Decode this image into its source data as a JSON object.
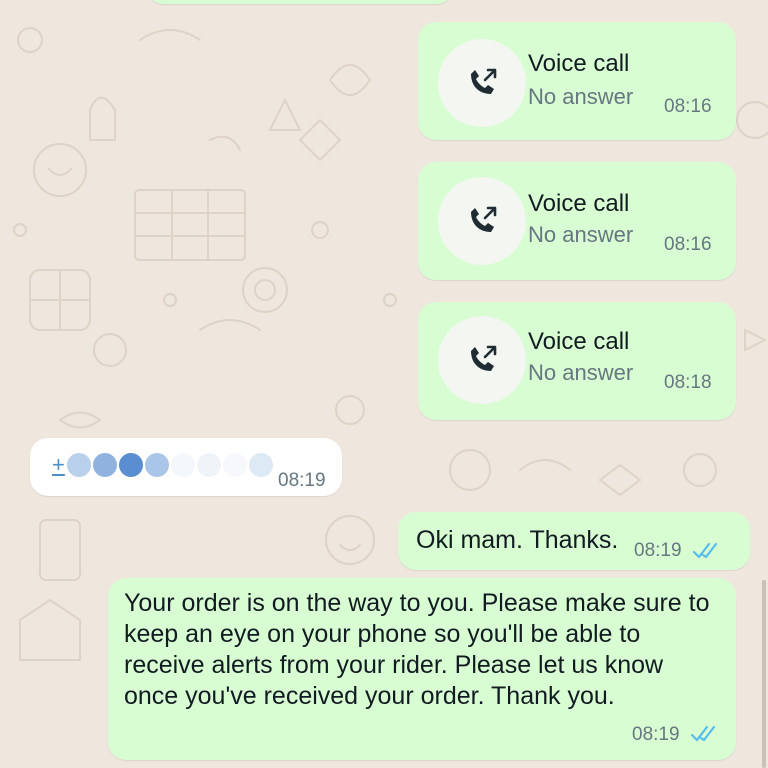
{
  "colors": {
    "wallpaper": "#efe7de",
    "outgoing_bubble": "#d9fdd3",
    "incoming_bubble": "#ffffff",
    "read_ticks": "#53bdeb"
  },
  "calls": [
    {
      "icon": "outgoing-call-icon",
      "title": "Voice call",
      "status": "No answer",
      "time": "08:16"
    },
    {
      "icon": "outgoing-call-icon",
      "title": "Voice call",
      "status": "No answer",
      "time": "08:16"
    },
    {
      "icon": "outgoing-call-icon",
      "title": "Voice call",
      "status": "No answer",
      "time": "08:18"
    }
  ],
  "incoming": {
    "content": "+",
    "time": "08:19"
  },
  "messages": [
    {
      "text": "Oki mam. Thanks.",
      "time": "08:19",
      "status_icon": "double-check-icon"
    },
    {
      "text": "Your order is on the way to you. Please make sure to keep an eye on your phone so you'll be able to receive alerts from your rider. Please let us know once you've received your order. Thank you.",
      "time": "08:19",
      "status_icon": "double-check-icon"
    }
  ]
}
